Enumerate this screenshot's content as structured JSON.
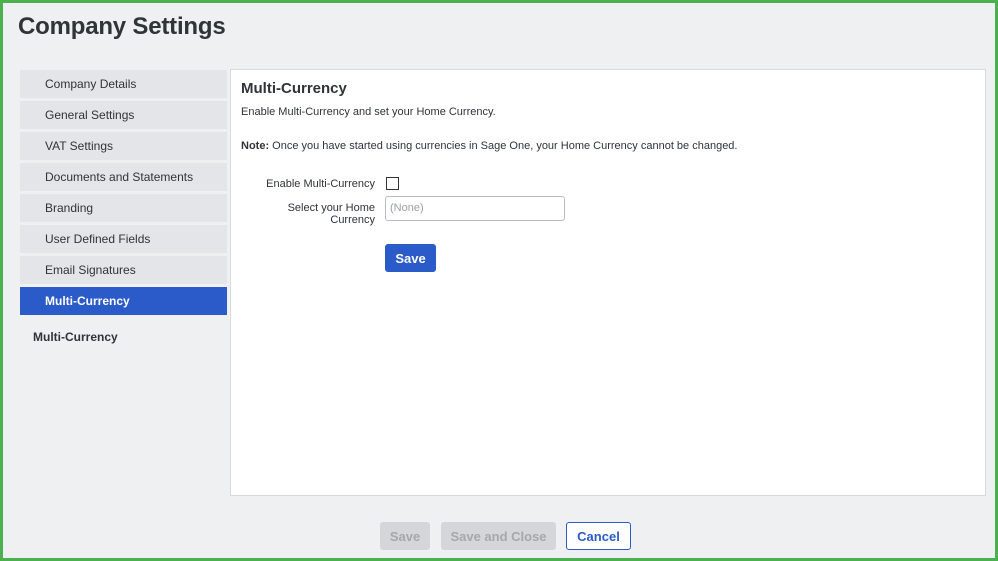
{
  "page": {
    "title": "Company Settings"
  },
  "sidebar": {
    "items": [
      {
        "label": "Company Details"
      },
      {
        "label": "General Settings"
      },
      {
        "label": "VAT Settings"
      },
      {
        "label": "Documents and Statements"
      },
      {
        "label": "Branding"
      },
      {
        "label": "User Defined Fields"
      },
      {
        "label": "Email Signatures"
      },
      {
        "label": "Multi-Currency"
      }
    ],
    "active_index": 7,
    "caption": "Multi-Currency"
  },
  "panel": {
    "title": "Multi-Currency",
    "description": "Enable Multi-Currency and set your Home Currency.",
    "note_label": "Note:",
    "note_text": " Once you have started using currencies in Sage One, your Home Currency cannot be changed.",
    "enable_label": "Enable Multi-Currency",
    "enable_checked": false,
    "currency_label": "Select your Home Currency",
    "currency_value": "(None)",
    "save_label": "Save"
  },
  "footer": {
    "save_label": "Save",
    "save_close_label": "Save and Close",
    "cancel_label": "Cancel"
  },
  "colors": {
    "accent": "#2a5bc9",
    "frame_border": "#4caf50",
    "background": "#eef0f2"
  }
}
